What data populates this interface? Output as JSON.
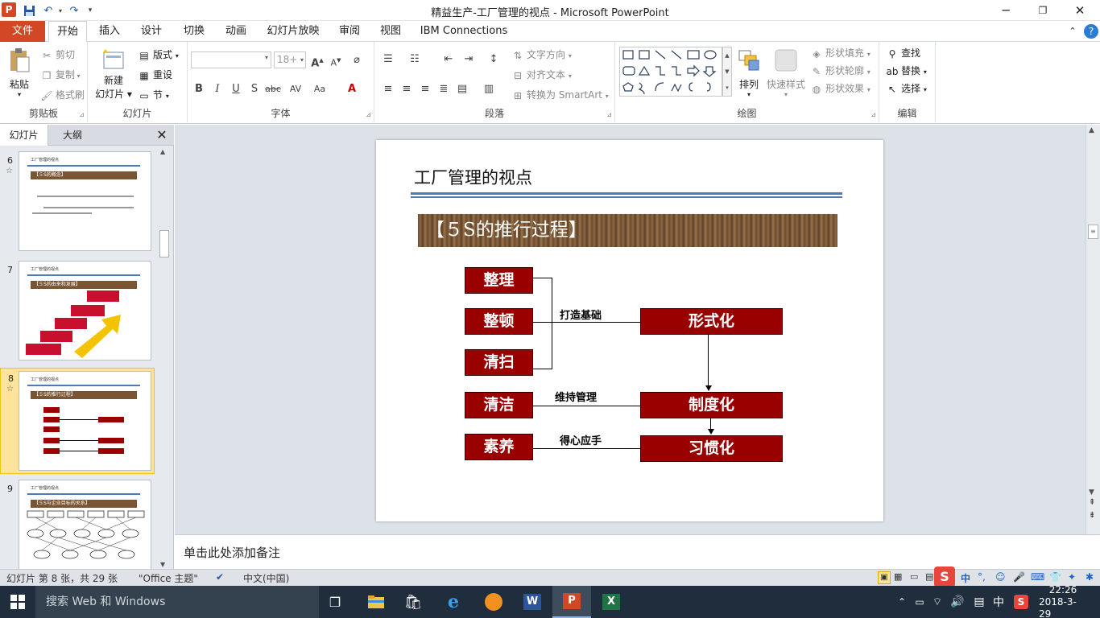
{
  "window": {
    "title": "精益生产-工厂管理的视点 - Microsoft PowerPoint",
    "app_logo": "P"
  },
  "qat": {
    "save_icon": "save-icon",
    "undo_icon": "undo-icon",
    "redo_icon": "redo-icon"
  },
  "menubar": {
    "file": "文件",
    "tabs": [
      "开始",
      "插入",
      "设计",
      "切换",
      "动画",
      "幻灯片放映",
      "审阅",
      "视图",
      "IBM Connections"
    ]
  },
  "ribbon": {
    "clipboard": {
      "paste": "粘贴",
      "cut": "剪切",
      "copy": "复制",
      "format_painter": "格式刷",
      "label": "剪贴板"
    },
    "slides": {
      "new_slide": "新建",
      "new_slide2": "幻灯片",
      "layout": "版式",
      "reset": "重设",
      "section": "节",
      "label": "幻灯片"
    },
    "font": {
      "font_size": "18+",
      "label": "字体"
    },
    "paragraph": {
      "text_direction": "文字方向",
      "align_text": "对齐文本",
      "smartart": "转换为 SmartArt",
      "label": "段落"
    },
    "drawing": {
      "arrange": "排列",
      "quick_styles": "快速样式",
      "shape_fill": "形状填充",
      "shape_outline": "形状轮廓",
      "shape_effects": "形状效果",
      "label": "绘图"
    },
    "editing": {
      "find": "查找",
      "replace": "替换",
      "select": "选择",
      "label": "编辑"
    }
  },
  "left_pane": {
    "tabs": [
      "幻灯片",
      "大纲"
    ],
    "thumbnails": [
      {
        "num": "6",
        "title": "工厂管理的视点",
        "band": "【５S的概念】"
      },
      {
        "num": "7",
        "title": "工厂管理的视点",
        "band": "【５S的由来和发展】"
      },
      {
        "num": "8",
        "title": "工厂管理的视点",
        "band": "【５S的推行过程】"
      },
      {
        "num": "9",
        "title": "工厂管理的视点",
        "band": "【５S与企业目标的关系】"
      }
    ]
  },
  "slide": {
    "title": "工厂管理的视点",
    "banner": "【５S的推行过程】",
    "left_boxes": [
      "整理",
      "整顿",
      "清扫",
      "清洁",
      "素养"
    ],
    "right_boxes": [
      "形式化",
      "制度化",
      "习惯化"
    ],
    "labels": {
      "foundation": "打造基础",
      "maintain": "维持管理",
      "mastery": "得心应手"
    }
  },
  "notes": {
    "placeholder": "单击此处添加备注"
  },
  "statusbar": {
    "slide_info": "幻灯片 第 8 张，共 29 张",
    "theme": "\"Office 主题\"",
    "language": "中文(中国)"
  },
  "taskbar": {
    "search": "搜索 Web 和 Windows",
    "time": "22:26",
    "date": "2018-3-29",
    "ime": "中"
  }
}
